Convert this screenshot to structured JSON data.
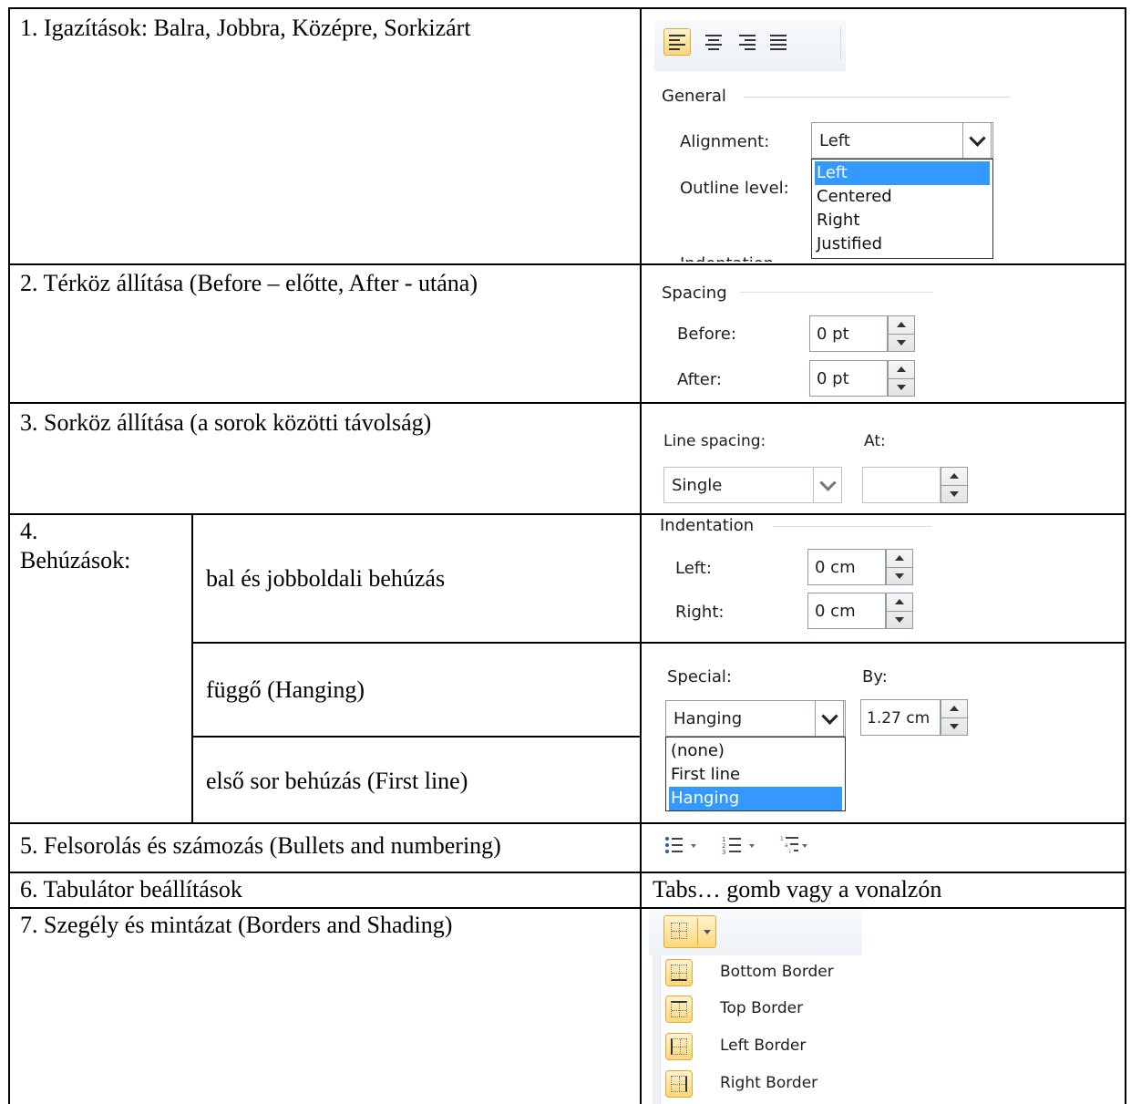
{
  "rows": {
    "r1": "1. Igazítások: Balra, Jobbra, Középre, Sorkizárt",
    "r2": "2. Térköz állítása (Before – előtte, After - utána)",
    "r3": "3. Sorköz állítása (a sorok közötti távolság)",
    "r4_num": "4.",
    "r4_title": "Behúzások:",
    "r4a": "bal és jobboldali behúzás",
    "r4b": "függő (Hanging)",
    "r4c": "első sor behúzás (First line)",
    "r5": "5. Felsorolás és számozás (Bullets and numbering)",
    "r6": "6. Tabulátor beállítások",
    "r6_right": "Tabs… gomb vagy a vonalzón",
    "r7": "7. Szegély és mintázat (Borders and Shading)"
  },
  "general": {
    "group": "General",
    "alignment_label": "Alignment:",
    "alignment_value": "Left",
    "outline_label": "Outline level:",
    "options": [
      "Left",
      "Centered",
      "Right",
      "Justified"
    ],
    "cut_text": "Indentation"
  },
  "spacing": {
    "group": "Spacing",
    "before_label": "Before:",
    "before_value": "0 pt",
    "after_label": "After:",
    "after_value": "0 pt"
  },
  "line_spacing": {
    "label": "Line spacing:",
    "at_label": "At:",
    "value": "Single",
    "at_value": ""
  },
  "indentation": {
    "group": "Indentation",
    "left_label": "Left:",
    "left_value": "0 cm",
    "right_label": "Right:",
    "right_value": "0 cm"
  },
  "special": {
    "label": "Special:",
    "by_label": "By:",
    "value": "Hanging",
    "by_value": "1.27 cm",
    "options": [
      "(none)",
      "First line",
      "Hanging"
    ]
  },
  "borders_menu": {
    "items": [
      "Bottom Border",
      "Top Border",
      "Left Border",
      "Right Border"
    ]
  },
  "colors": {
    "selection": "#3399ff",
    "button_highlight": "#ffd77a"
  }
}
